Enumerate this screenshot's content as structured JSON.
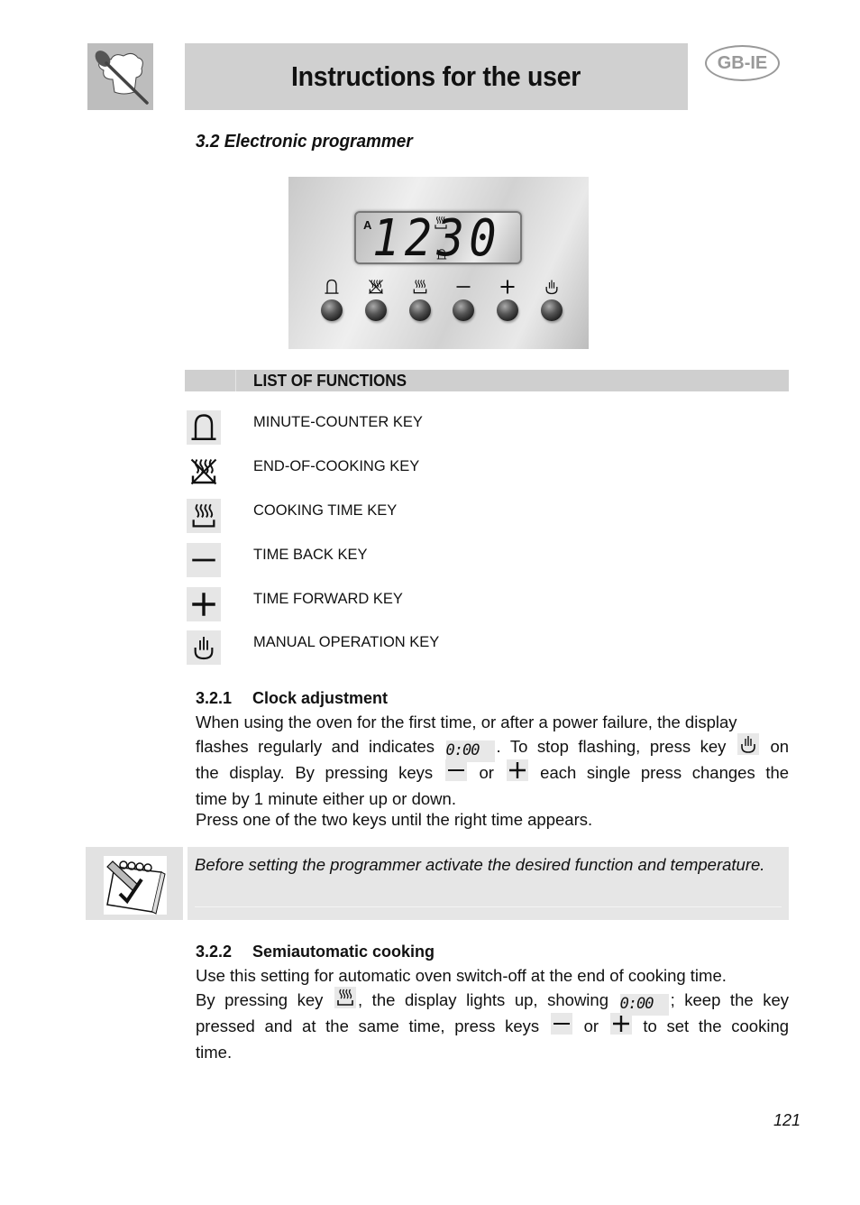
{
  "header": {
    "title": "Instructions for the user",
    "language_badge": "GB-IE",
    "logo_icon": "spoon-and-chef-hat-icon"
  },
  "section": {
    "title": "3.2 Electronic programmer"
  },
  "programmer_panel": {
    "display_indicator": "A",
    "display_time": "12:30",
    "display_digits": "1230",
    "keys": [
      {
        "icon": "bell-icon",
        "name": "minute-counter"
      },
      {
        "icon": "end-of-cooking-icon",
        "name": "end-of-cooking"
      },
      {
        "icon": "cooking-time-icon",
        "name": "cooking-time"
      },
      {
        "icon": "minus-icon",
        "name": "time-back"
      },
      {
        "icon": "plus-icon",
        "name": "time-forward"
      },
      {
        "icon": "hand-icon",
        "name": "manual-operation"
      }
    ]
  },
  "functions": {
    "header": "LIST OF FUNCTIONS",
    "items": [
      {
        "icon": "bell-icon",
        "label": "MINUTE-COUNTER KEY"
      },
      {
        "icon": "end-of-cooking-icon",
        "label": "END-OF-COOKING KEY"
      },
      {
        "icon": "cooking-time-icon",
        "label": "COOKING TIME KEY"
      },
      {
        "icon": "minus-icon",
        "label": "TIME BACK KEY"
      },
      {
        "icon": "plus-icon",
        "label": "TIME FORWARD KEY"
      },
      {
        "icon": "hand-icon",
        "label": "MANUAL OPERATION KEY"
      }
    ]
  },
  "clock_adjustment": {
    "number": "3.2.1",
    "title": "Clock adjustment",
    "line1": "When using the oven for the first time, or after a power failure, the display",
    "line2a": "flashes regularly and indicates",
    "display_value": "0:00",
    "line2b": ". To stop flashing, press key",
    "line2c": "on",
    "line3a": "the display. By pressing keys",
    "line3b": "or",
    "line3c": "each single press changes the",
    "line4": "time by 1 minute either up or down.",
    "line5": "Press one of the two keys until the right time appears."
  },
  "note": {
    "icon": "notepad-check-icon",
    "text": "Before setting the programmer activate the desired function and temperature."
  },
  "semiautomatic_cooking": {
    "number": "3.2.2",
    "title": "Semiautomatic cooking",
    "line1": "Use this setting for automatic oven switch-off at the end of cooking time.",
    "line2a": "By pressing key",
    "line2b": ", the display lights up, showing",
    "display_value": "0:00",
    "line2c": "; keep the key",
    "line3a": "pressed and at the same time, press keys",
    "line3b": "or",
    "line3c": "to set the cooking",
    "line4": "time."
  },
  "page_number": "121"
}
